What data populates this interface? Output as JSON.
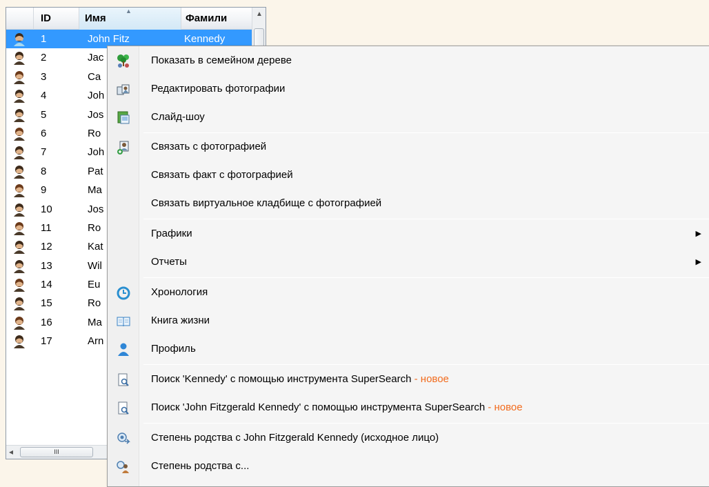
{
  "grid": {
    "headers": {
      "id": "ID",
      "name": "Имя",
      "last": "Фамили"
    },
    "scroll_thumb_glyph": "III",
    "rows": [
      {
        "id": "1",
        "name": "John Fitz",
        "last": "Kennedy",
        "selected": true
      },
      {
        "id": "2",
        "name": "Jac",
        "last": ""
      },
      {
        "id": "3",
        "name": "Ca",
        "last": ""
      },
      {
        "id": "4",
        "name": "Joh",
        "last": ""
      },
      {
        "id": "5",
        "name": "Jos",
        "last": ""
      },
      {
        "id": "6",
        "name": "Ro",
        "last": ""
      },
      {
        "id": "7",
        "name": "Joh",
        "last": ""
      },
      {
        "id": "8",
        "name": "Pat",
        "last": ""
      },
      {
        "id": "9",
        "name": "Ma",
        "last": ""
      },
      {
        "id": "10",
        "name": "Jos",
        "last": ""
      },
      {
        "id": "11",
        "name": "Ro",
        "last": ""
      },
      {
        "id": "12",
        "name": "Kat",
        "last": ""
      },
      {
        "id": "13",
        "name": "Wil",
        "last": ""
      },
      {
        "id": "14",
        "name": "Eu",
        "last": ""
      },
      {
        "id": "15",
        "name": "Ro",
        "last": ""
      },
      {
        "id": "16",
        "name": "Ma",
        "last": ""
      },
      {
        "id": "17",
        "name": "Arn",
        "last": ""
      }
    ]
  },
  "menu": {
    "items": [
      {
        "label": "Показать в семейном дереве",
        "icon": "family-tree-icon"
      },
      {
        "label": "Редактировать фотографии",
        "icon": "photos-edit-icon"
      },
      {
        "label": "Слайд-шоу",
        "icon": "slideshow-icon"
      },
      {
        "label": "Связать с фотографией",
        "icon": "link-photo-icon"
      },
      {
        "label": "Связать факт с фотографией",
        "icon": ""
      },
      {
        "label": "Связать виртуальное кладбище с фотографией",
        "icon": ""
      },
      {
        "label": "Графики",
        "icon": "",
        "submenu": true
      },
      {
        "label": "Отчеты",
        "icon": "",
        "submenu": true
      },
      {
        "label": "Хронология",
        "icon": "timeline-icon"
      },
      {
        "label": "Книга жизни",
        "icon": "book-icon"
      },
      {
        "label": "Профиль",
        "icon": "profile-icon"
      },
      {
        "label": "Поиск 'Kennedy' с помощью инструмента SuperSearch",
        "new": " - новое",
        "icon": "search-doc-icon"
      },
      {
        "label": "Поиск 'John Fitzgerald Kennedy' с помощью инструмента SuperSearch",
        "new": " - новое",
        "icon": "search-doc-icon"
      },
      {
        "label": "Степень родства с John Fitzgerald Kennedy (исходное лицо)",
        "icon": "relationship-icon"
      },
      {
        "label": "Степень родства с...",
        "icon": "relationship-people-icon"
      }
    ]
  },
  "colors": {
    "selection": "#3399ff",
    "new_tag": "#f26b1d",
    "background": "#fbf5ea"
  }
}
